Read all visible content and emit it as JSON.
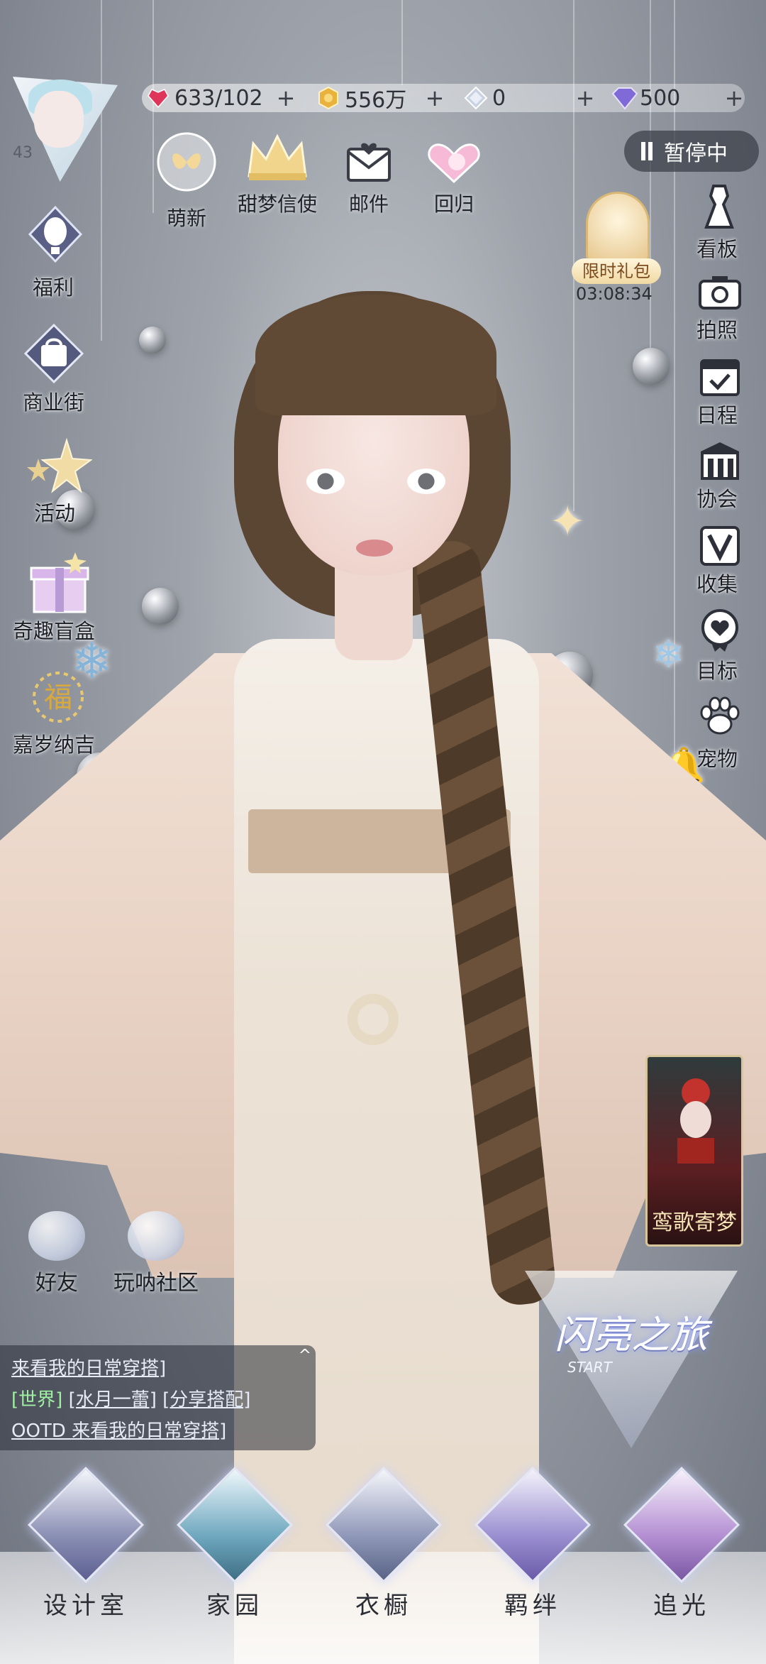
{
  "player": {
    "level": "43"
  },
  "currencies": [
    {
      "name": "stamina",
      "value": "633/102",
      "icon": "heart-gem-icon",
      "color": "#e0355b"
    },
    {
      "name": "gold",
      "value": "556万",
      "icon": "gold-coin-icon",
      "color": "#e8b23d"
    },
    {
      "name": "crystal",
      "value": "0",
      "icon": "crystal-icon",
      "color": "#b9c3d6"
    },
    {
      "name": "diamond",
      "value": "500",
      "icon": "diamond-icon",
      "color": "#7f6ad8"
    }
  ],
  "top_icons": [
    {
      "label": "萌新",
      "icon": "bubble-butterfly-icon"
    },
    {
      "label": "甜梦信使",
      "icon": "crown-icon"
    },
    {
      "label": "邮件",
      "icon": "mail-icon"
    },
    {
      "label": "回归",
      "icon": "return-icon"
    }
  ],
  "pause": {
    "label": "暂停中"
  },
  "gift": {
    "label": "限时礼包",
    "timer": "03:08:34"
  },
  "left_menu": [
    {
      "label": "福利",
      "icon": "balloon-icon"
    },
    {
      "label": "商业街",
      "icon": "shopping-bag-icon"
    },
    {
      "label": "活动",
      "icon": "stars-icon"
    },
    {
      "label": "奇趣盲盒",
      "icon": "gift-box-icon"
    },
    {
      "label": "嘉岁纳吉",
      "icon": "fortune-icon"
    }
  ],
  "right_menu": [
    {
      "label": "看板",
      "icon": "dress-form-icon"
    },
    {
      "label": "拍照",
      "icon": "camera-icon"
    },
    {
      "label": "日程",
      "icon": "calendar-icon"
    },
    {
      "label": "协会",
      "icon": "guild-icon"
    },
    {
      "label": "收集",
      "icon": "collection-icon"
    },
    {
      "label": "目标",
      "icon": "target-icon"
    },
    {
      "label": "宠物",
      "icon": "paw-icon"
    }
  ],
  "social": [
    {
      "label": "好友",
      "icon": "friends-icon"
    },
    {
      "label": "玩呐社区",
      "icon": "community-icon"
    }
  ],
  "chat": {
    "line1": "来看我的日常穿搭]",
    "channel": "[世界]",
    "user": "[水月一蕾]",
    "share": "[分享搭配]",
    "line3": "OOTD 来看我的日常穿搭]"
  },
  "event_card": {
    "title": "鸾歌寄梦"
  },
  "journey": {
    "title": "闪亮之旅",
    "sub": "START"
  },
  "bottom_nav": [
    {
      "label": "设计室",
      "icon": "design-studio-icon"
    },
    {
      "label": "家园",
      "icon": "home-key-icon"
    },
    {
      "label": "衣橱",
      "icon": "wardrobe-snowflake-icon"
    },
    {
      "label": "羁绊",
      "icon": "bond-clover-icon"
    },
    {
      "label": "追光",
      "icon": "butterfly-icon"
    }
  ]
}
